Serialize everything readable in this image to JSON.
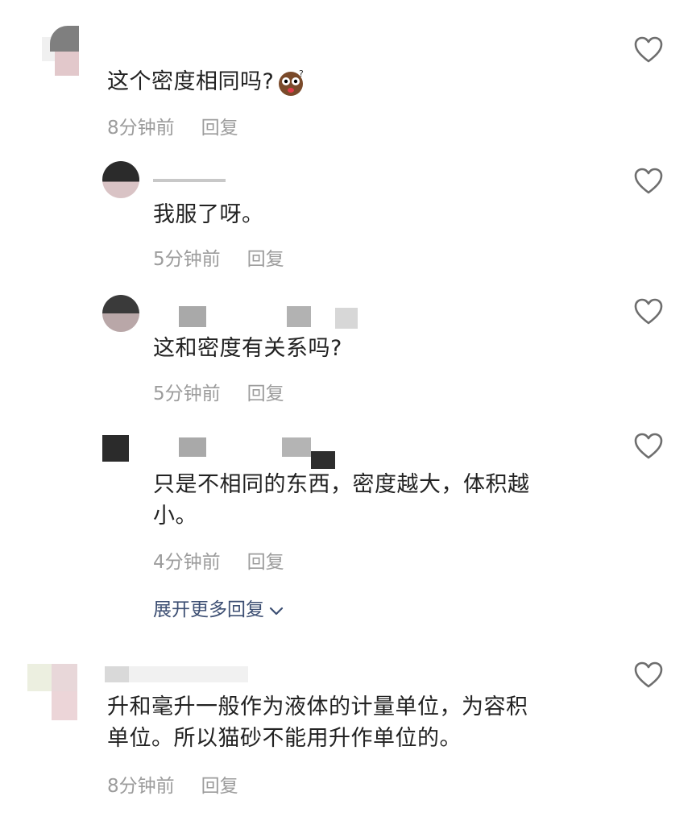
{
  "comments": [
    {
      "text": "这个密度相同吗?",
      "time": "8分钟前",
      "reply_label": "回复",
      "replies": [
        {
          "text": "我服了呀。",
          "time": "5分钟前",
          "reply_label": "回复"
        },
        {
          "text": "这和密度有关系吗?",
          "time": "5分钟前",
          "reply_label": "回复"
        },
        {
          "text_line1": "只是不相同的东西，密度越大，体积越",
          "text_line2": "小。",
          "time": "4分钟前",
          "reply_label": "回复"
        }
      ],
      "expand_label": "展开更多回复"
    },
    {
      "text_line1": "升和毫升一般作为液体的计量单位，为容积",
      "text_line2": "单位。所以猫砂不能用升作单位的。",
      "time": "8分钟前",
      "reply_label": "回复"
    }
  ],
  "icons": {
    "like": "heart-outline-icon",
    "emoji": "shocked-face-emoji-icon",
    "expand": "chevron-down-icon"
  },
  "colors": {
    "text": "#222222",
    "meta": "#9c9c9c",
    "link": "#3d4f73",
    "icon": "#6e6e6e"
  }
}
